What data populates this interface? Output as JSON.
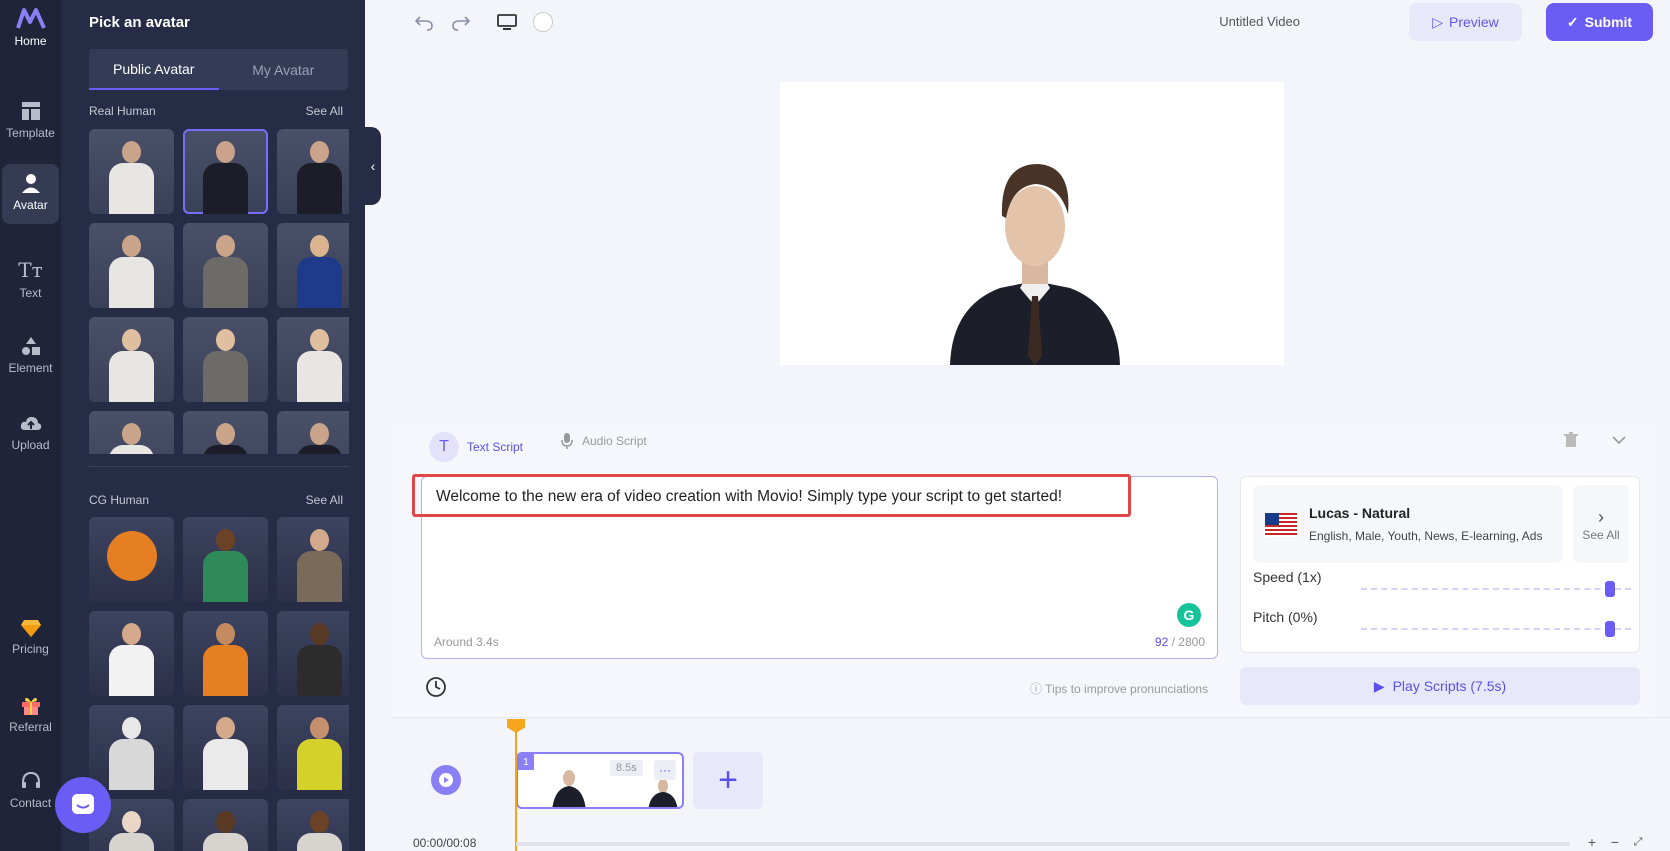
{
  "nav": {
    "items": [
      {
        "label": "Home",
        "icon": "movio-logo-icon"
      },
      {
        "label": "Template",
        "icon": "template-icon"
      },
      {
        "label": "Avatar",
        "icon": "user-icon"
      },
      {
        "label": "Text",
        "icon": "text-icon"
      },
      {
        "label": "Element",
        "icon": "shapes-icon"
      },
      {
        "label": "Upload",
        "icon": "cloud-upload-icon"
      },
      {
        "label": "Pricing",
        "icon": "diamond-icon"
      },
      {
        "label": "Referral",
        "icon": "gift-icon"
      },
      {
        "label": "Contact",
        "icon": "headset-icon"
      }
    ],
    "active": "Avatar"
  },
  "panel": {
    "title": "Pick an avatar",
    "tabs": [
      "Public Avatar",
      "My Avatar"
    ],
    "active_tab": "Public Avatar",
    "sections": [
      {
        "title": "Real Human",
        "see_all": "See All"
      },
      {
        "title": "CG Human",
        "see_all": "See All"
      }
    ]
  },
  "topbar": {
    "video_title": "Untitled Video",
    "preview_label": "Preview",
    "submit_label": "Submit"
  },
  "script": {
    "tabs": [
      "Text Script",
      "Audio Script"
    ],
    "active_tab": "Text Script",
    "text": "Welcome to the new era of video creation with Movio! Simply type your script to get started!",
    "duration_estimate": "Around 3.4s",
    "char_count": "92",
    "char_limit": "/ 2800",
    "tips": "Tips to improve pronunciations"
  },
  "voice": {
    "name": "Lucas - Natural",
    "tags": "English, Male, Youth, News, E-learning, Ads",
    "see_all": "See All",
    "speed_label": "Speed (1x)",
    "pitch_label": "Pitch (0%)",
    "play_label": "Play Scripts (7.5s)"
  },
  "timeline": {
    "clip_number": "1",
    "clip_duration": "8.5s",
    "time": "00:00/00:08"
  },
  "colors": {
    "accent": "#6c5cf6",
    "sidebar": "#1f2438",
    "panel": "#262c45",
    "highlight": "#e04848",
    "playhead": "#f4a51c"
  }
}
